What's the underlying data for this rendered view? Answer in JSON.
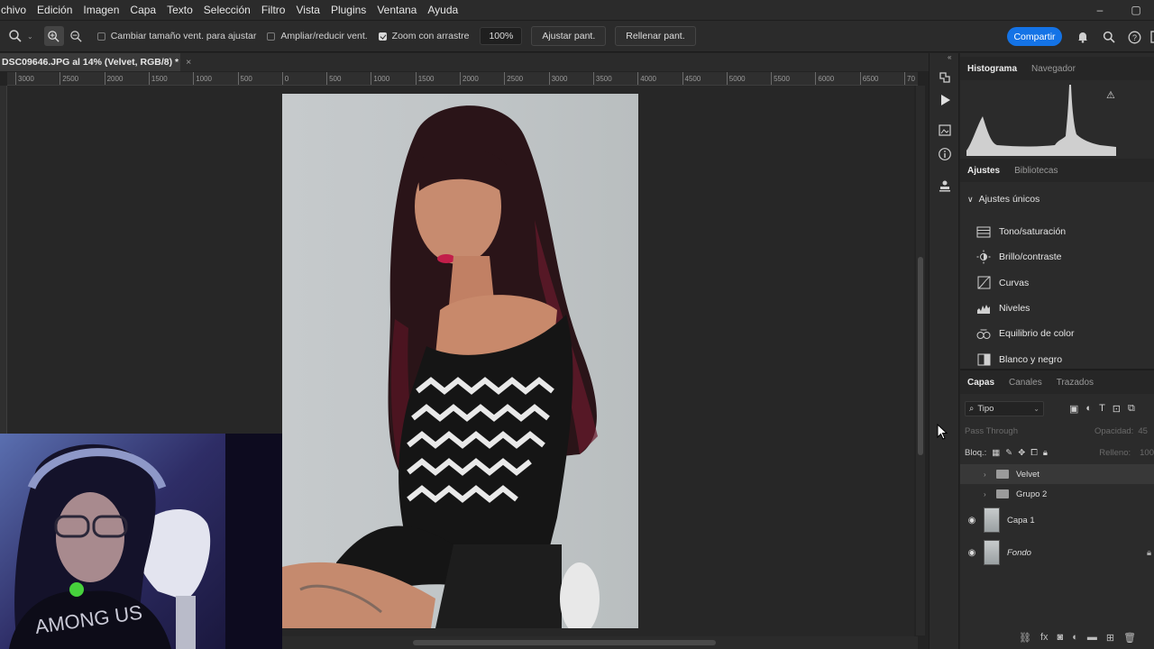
{
  "menu": [
    "chivo",
    "Edición",
    "Imagen",
    "Capa",
    "Texto",
    "Selección",
    "Filtro",
    "Vista",
    "Plugins",
    "Ventana",
    "Ayuda"
  ],
  "window_controls": [
    "–",
    "▢"
  ],
  "options": {
    "resize_window": "Cambiar tamaño vent. para ajustar",
    "zoom_all": "Ampliar/reducir vent.",
    "scrubby_zoom": "Zoom con arrastre",
    "zoom_value": "100%",
    "fit_screen": "Ajustar pant.",
    "fill_screen": "Rellenar pant.",
    "share": "Compartir"
  },
  "document": {
    "tab_title": "DSC09646.JPG al 14% (Velvet, RGB/8) *",
    "close": "×"
  },
  "ruler_ticks": [
    "3000",
    "2500",
    "2000",
    "1500",
    "1000",
    "500",
    "0",
    "500",
    "1000",
    "1500",
    "2000",
    "2500",
    "3000",
    "3500",
    "4000",
    "4500",
    "5000",
    "5500",
    "6000",
    "6500",
    "70"
  ],
  "panels": {
    "top_tabs": [
      "Histograma",
      "Navegador"
    ],
    "mid_tabs": [
      "Ajustes",
      "Bibliotecas"
    ],
    "adjustments_header": "Ajustes únicos",
    "adjustments": [
      {
        "label": "Tono/saturación",
        "icon": "hue-saturation-icon"
      },
      {
        "label": "Brillo/contraste",
        "icon": "brightness-icon"
      },
      {
        "label": "Curvas",
        "icon": "curves-icon"
      },
      {
        "label": "Niveles",
        "icon": "levels-icon"
      },
      {
        "label": "Equilibrio de color",
        "icon": "color-balance-icon"
      },
      {
        "label": "Blanco y negro",
        "icon": "black-white-icon"
      }
    ],
    "layer_tabs": [
      "Capas",
      "Canales",
      "Trazados"
    ],
    "filter_label": "Tipo",
    "blend_mode": "Pass Through",
    "opacity_label": "Opacidad:",
    "opacity_value": "45",
    "lock_label": "Bloq.:",
    "fill_label": "Relleno:",
    "fill_value": "100",
    "layers": [
      {
        "name": "Velvet",
        "type": "group",
        "visible": false,
        "selected": true
      },
      {
        "name": "Grupo 2",
        "type": "group",
        "visible": false,
        "selected": false
      },
      {
        "name": "Capa 1",
        "type": "pixel",
        "visible": true,
        "selected": false
      },
      {
        "name": "Fondo",
        "type": "background",
        "visible": true,
        "selected": false
      }
    ]
  }
}
